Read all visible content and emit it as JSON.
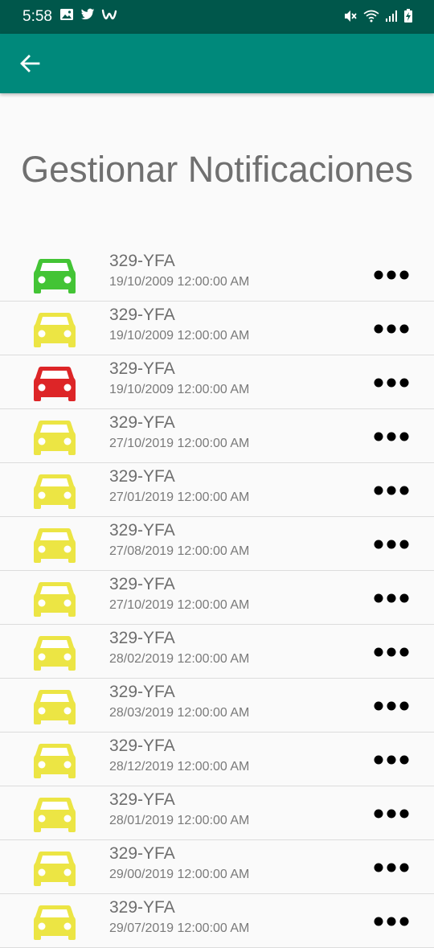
{
  "status_bar": {
    "time": "5:58",
    "left_icons": [
      "image-icon",
      "twitter-icon",
      "app-w-icon"
    ],
    "right_icons": [
      "mute-icon",
      "wifi-icon",
      "signal-icon",
      "battery-charging-icon"
    ]
  },
  "app_bar": {
    "back_icon": "arrow-back-icon",
    "color": "#00897b"
  },
  "page": {
    "title": "Gestionar Notificaciones"
  },
  "colors": {
    "green": "#43c435",
    "yellow": "#ece544",
    "red": "#dd2527",
    "status_bar": "#00574b"
  },
  "notifications": [
    {
      "status": "green",
      "plate": "329-YFA",
      "date": "19/10/2009 12:00:00 AM"
    },
    {
      "status": "yellow",
      "plate": "329-YFA",
      "date": "19/10/2009 12:00:00 AM"
    },
    {
      "status": "red",
      "plate": "329-YFA",
      "date": "19/10/2009 12:00:00 AM"
    },
    {
      "status": "yellow",
      "plate": "329-YFA",
      "date": "27/10/2019 12:00:00 AM"
    },
    {
      "status": "yellow",
      "plate": "329-YFA",
      "date": "27/01/2019 12:00:00 AM"
    },
    {
      "status": "yellow",
      "plate": "329-YFA",
      "date": "27/08/2019 12:00:00 AM"
    },
    {
      "status": "yellow",
      "plate": "329-YFA",
      "date": "27/10/2019 12:00:00 AM"
    },
    {
      "status": "yellow",
      "plate": "329-YFA",
      "date": "28/02/2019 12:00:00 AM"
    },
    {
      "status": "yellow",
      "plate": "329-YFA",
      "date": "28/03/2019 12:00:00 AM"
    },
    {
      "status": "yellow",
      "plate": "329-YFA",
      "date": "28/12/2019 12:00:00 AM"
    },
    {
      "status": "yellow",
      "plate": "329-YFA",
      "date": "28/01/2019 12:00:00 AM"
    },
    {
      "status": "yellow",
      "plate": "329-YFA",
      "date": "29/00/2019 12:00:00 AM"
    },
    {
      "status": "yellow",
      "plate": "329-YFA",
      "date": "29/07/2019 12:00:00 AM"
    }
  ]
}
